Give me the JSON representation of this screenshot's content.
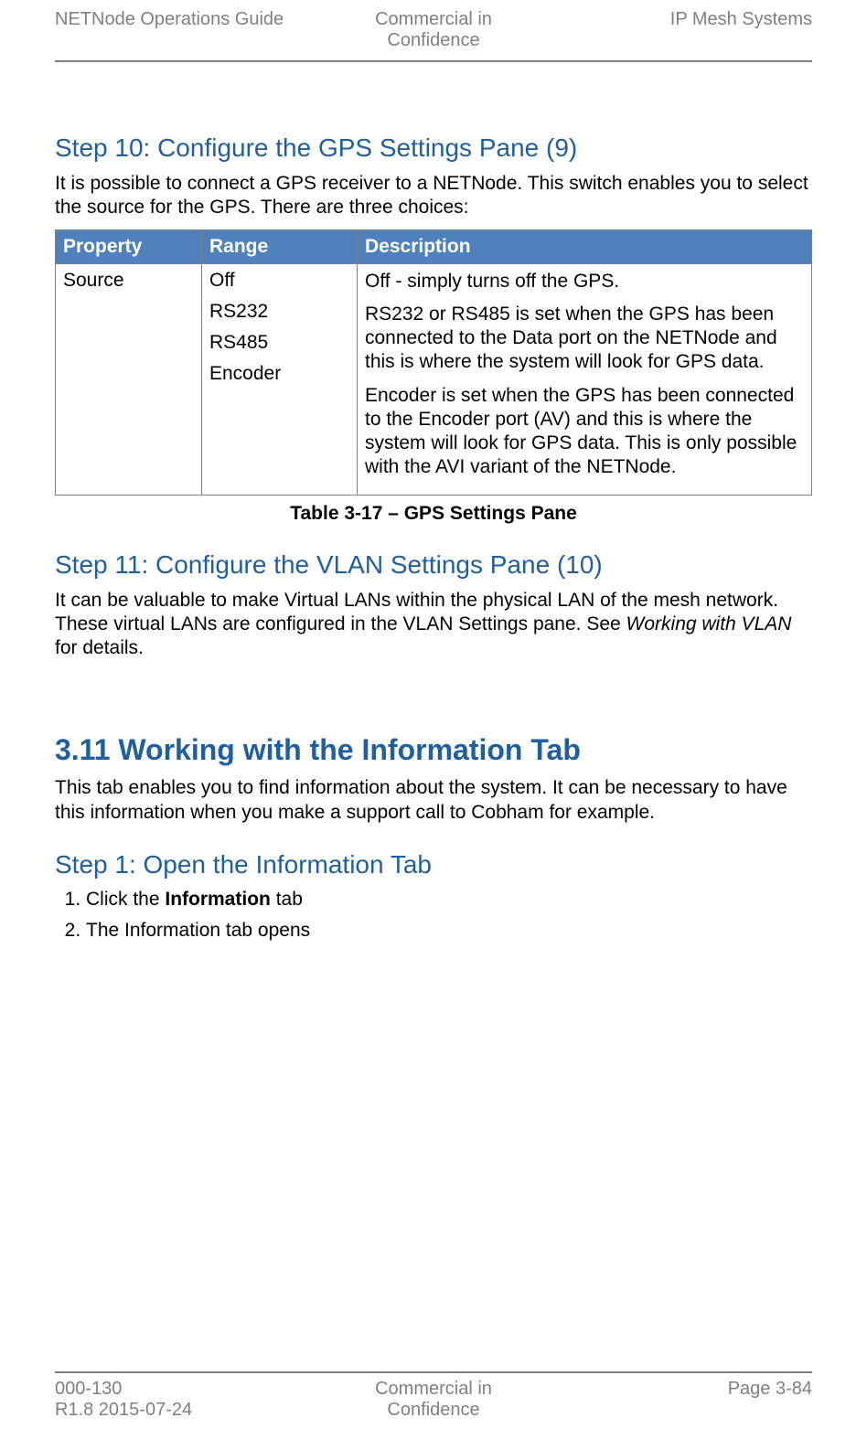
{
  "header": {
    "left": "NETNode Operations Guide",
    "center_line1": "Commercial in",
    "center_line2": "Confidence",
    "right": "IP Mesh Systems"
  },
  "sections": {
    "step10": {
      "title": "Step 10: Configure the GPS Settings Pane (9)",
      "intro": "It is possible to connect a GPS receiver to a NETNode. This switch enables you to select the source for the GPS. There are three choices:",
      "table": {
        "col_property": "Property",
        "col_range": "Range",
        "col_description": "Description",
        "rows": [
          {
            "property": "Source",
            "range": [
              "Off",
              "RS232",
              "RS485",
              "Encoder"
            ],
            "desc": [
              "Off - simply turns off the GPS.",
              "RS232 or RS485 is set when the GPS has been connected to the Data port on the NETNode and this is where the system will look for GPS data.",
              "Encoder is set when the GPS has been connected to the Encoder port (AV) and this is where the system will look for GPS data. This is only possible with the AVI variant of the NETNode."
            ]
          }
        ]
      },
      "caption": "Table 3-17 – GPS Settings Pane"
    },
    "step11": {
      "title": "Step 11: Configure the VLAN Settings Pane (10)",
      "intro_pre": "It can be valuable to make Virtual LANs within the physical LAN of the mesh network. These virtual LANs are configured in the VLAN Settings pane. See ",
      "intro_em": "Working with VLAN",
      "intro_post": " for details."
    },
    "section311": {
      "title": "3.11   Working with the Information Tab",
      "intro": "This tab enables you to find information about the system. It can be necessary to have this information when you make a support call to Cobham for example.",
      "step1": {
        "title": "Step 1: Open the Information Tab",
        "li1_pre": "Click the ",
        "li1_bold": "Information",
        "li1_post": " tab",
        "li2": "The Information tab opens"
      }
    }
  },
  "footer": {
    "left_line1": "000-130",
    "left_line2": "R1.8 2015-07-24",
    "center_line1": "Commercial in",
    "center_line2": "Confidence",
    "right": "Page 3-84"
  }
}
